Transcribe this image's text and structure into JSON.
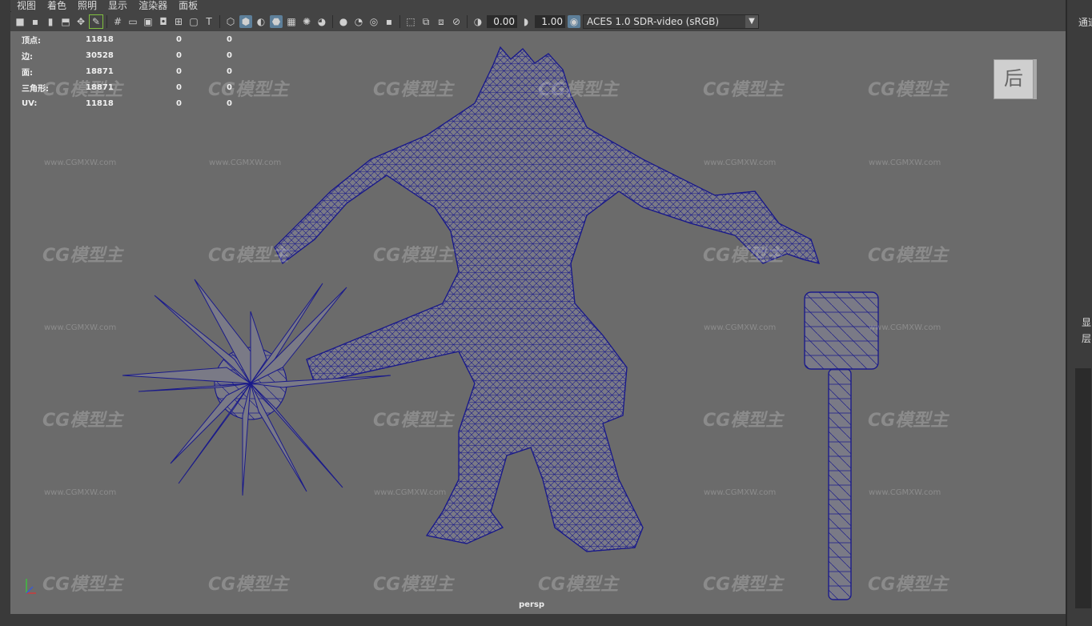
{
  "menu": [
    "视图",
    "着色",
    "照明",
    "显示",
    "渲染器",
    "面板"
  ],
  "toolbar": {
    "exposure_value": "0.00",
    "gamma_value": "1.00",
    "color_space": "ACES 1.0 SDR-video (sRGB)"
  },
  "hud": {
    "rows": [
      {
        "label": "顶点:",
        "v1": "11818",
        "v2": "0",
        "v3": "0"
      },
      {
        "label": "边:",
        "v1": "30528",
        "v2": "0",
        "v3": "0"
      },
      {
        "label": "面:",
        "v1": "18871",
        "v2": "0",
        "v3": "0"
      },
      {
        "label": "三角形:",
        "v1": "18871",
        "v2": "0",
        "v3": "0"
      },
      {
        "label": "UV:",
        "v1": "11818",
        "v2": "0",
        "v3": "0"
      }
    ]
  },
  "viewcube_label": "后",
  "camera_label": "persp",
  "right_panel": {
    "title": "通道",
    "label1": "显",
    "label2": "层"
  },
  "watermark": {
    "logo": "CG模型主",
    "url": "www.CGMXW.com"
  },
  "colors": {
    "wire": "#1a1a8a",
    "mesh": "#7a7a86",
    "viewport": "#6b6b6b"
  }
}
